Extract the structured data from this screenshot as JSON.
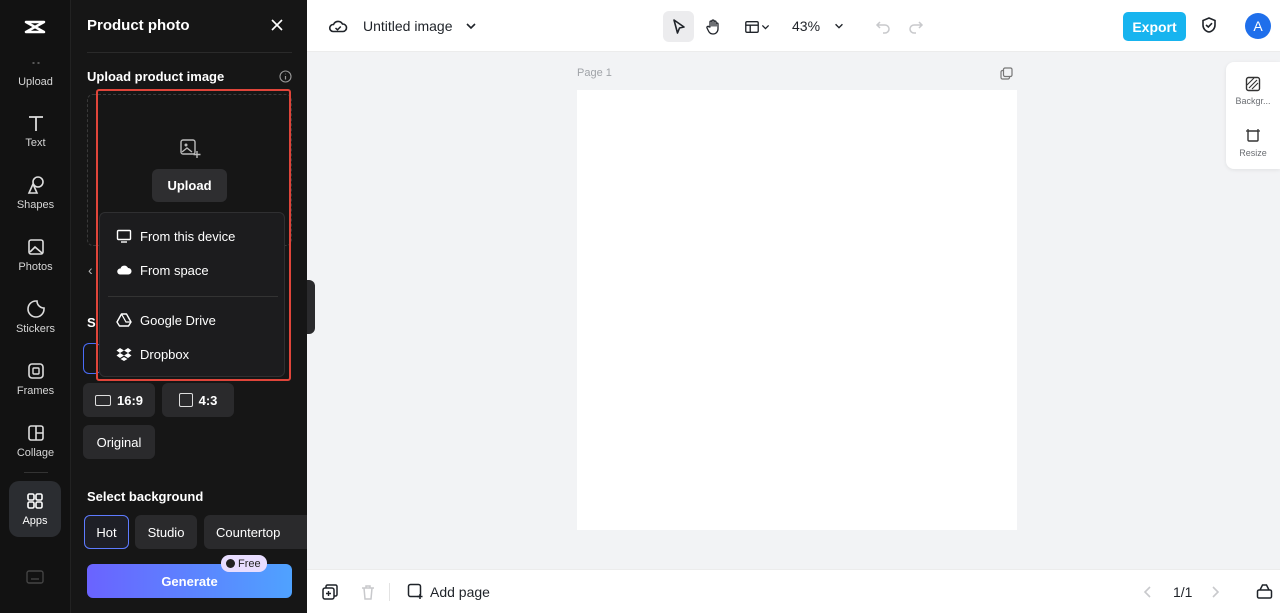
{
  "rail": {
    "items": [
      {
        "label": "Upload"
      },
      {
        "label": "Text"
      },
      {
        "label": "Shapes"
      },
      {
        "label": "Photos"
      },
      {
        "label": "Stickers"
      },
      {
        "label": "Frames"
      },
      {
        "label": "Collage"
      },
      {
        "label": "Apps"
      }
    ]
  },
  "panel": {
    "title": "Product photo",
    "upload_label": "Upload product image",
    "upload_button": "Upload",
    "size_label_stub": "S",
    "ratios": [
      "16:9",
      "4:3",
      "Original"
    ],
    "background_label": "Select background",
    "backgrounds": [
      "Hot",
      "Studio",
      "Countertop"
    ],
    "generate": "Generate",
    "free_badge": "Free"
  },
  "dropdown": {
    "items": [
      {
        "label": "From this device",
        "icon": "monitor-icon"
      },
      {
        "label": "From space",
        "icon": "cloud-icon"
      },
      {
        "label": "Google Drive",
        "icon": "google-drive-icon"
      },
      {
        "label": "Dropbox",
        "icon": "dropbox-icon"
      }
    ]
  },
  "topbar": {
    "doc_title": "Untitled image",
    "zoom": "43%",
    "export": "Export",
    "avatar_initial": "A"
  },
  "canvas": {
    "page_label": "Page 1"
  },
  "right_tools": {
    "background": "Backgr...",
    "resize": "Resize"
  },
  "bottombar": {
    "add_page": "Add page",
    "pager": "1/1"
  },
  "colors": {
    "accent": "#17b4ef",
    "highlight": "#e0453a",
    "panel_bg": "#161616"
  }
}
